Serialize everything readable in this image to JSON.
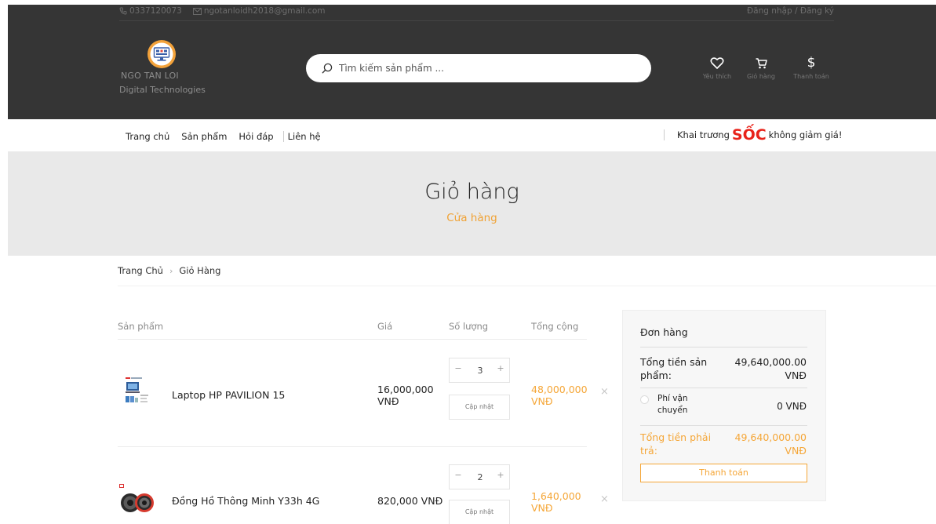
{
  "topbar": {
    "phone": "0337120073",
    "email": "ngotanloidh2018@gmail.com",
    "auth": "Đăng nhập / Đăng ký"
  },
  "logo": {
    "line1": "NGO TAN LOI",
    "line2": "Digital Technologies"
  },
  "search": {
    "placeholder": "Tìm kiếm sản phẩm ..."
  },
  "header_icons": [
    {
      "icon": "heart-icon",
      "label": "Yêu thích"
    },
    {
      "icon": "cart-icon",
      "label": "Giỏ hàng"
    },
    {
      "icon": "dollar-icon",
      "label": "Thanh toán"
    }
  ],
  "nav": {
    "items": [
      "Trang chủ",
      "Sản phẩm",
      "Hỏi đáp",
      "Liên hệ"
    ]
  },
  "promo": {
    "before": "Khai trương",
    "highlight": "SỐC",
    "after": "không giảm giá!",
    "highlight_color": "#e8231a"
  },
  "banner": {
    "title": "Giỏ hàng",
    "subtitle": "Cửa hàng"
  },
  "breadcrumb": {
    "home": "Trang Chủ",
    "current": "Giỏ Hàng"
  },
  "cart": {
    "headers": {
      "product": "Sản phẩm",
      "price": "Giá",
      "quantity": "Số lượng",
      "total": "Tổng cộng"
    },
    "update_label": "Cập nhật",
    "remove_glyph": "×",
    "items": [
      {
        "name": "Laptop HP PAVILION 15",
        "price": "16,000,000 VNĐ",
        "quantity": "3",
        "total": "48,000,000 VNĐ"
      },
      {
        "name": "Đồng Hồ Thông Minh Y33h 4G",
        "price": "820,000 VNĐ",
        "quantity": "2",
        "total": "1,640,000 VNĐ"
      }
    ]
  },
  "summary": {
    "title": "Đơn hàng",
    "subtotal_label": "Tổng tiền sản phẩm:",
    "subtotal_value": "49,640,000.00 VNĐ",
    "shipping_label": "Phí vận chuyển",
    "shipping_value": "0 VNĐ",
    "grand_label": "Tổng tiền phải trả:",
    "grand_value": "49,640,000.00 VNĐ",
    "checkout_label": "Thanh toán"
  },
  "colors": {
    "header_bg": "#353535",
    "accent": "#f5a637",
    "promo_red": "#e8231a",
    "banner_bg": "#e9e9e9"
  }
}
